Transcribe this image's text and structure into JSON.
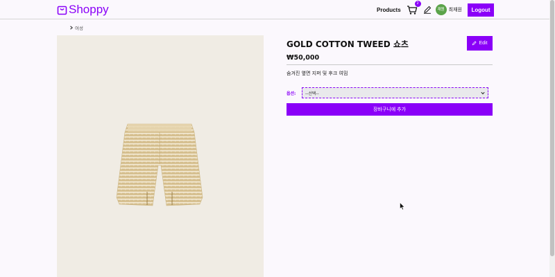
{
  "header": {
    "logo_text": "Shoppy",
    "nav_products": "Products",
    "cart_count": "2",
    "avatar_text": "재원",
    "username": "최재원",
    "logout_label": "Logout"
  },
  "breadcrumb": {
    "category": "여성"
  },
  "product": {
    "title": "GOLD COTTON TWEED 쇼츠",
    "price": "₩50,000",
    "description": "숨겨진 옆면 지퍼 및 후크 여밈",
    "edit_label": "Edit",
    "option_label": "옵션:",
    "option_selected": "--선택--",
    "add_to_cart_label": "장바구니에 추가"
  },
  "colors": {
    "accent": "#8a00f8",
    "avatar": "#5ba34a",
    "image_bg": "#f0ece4",
    "page_bg": "#fbf8fd"
  },
  "icons": [
    "shopping-bag-icon",
    "cart-icon",
    "pencil-icon",
    "chevron-right-icon",
    "chevron-down-icon",
    "mouse-cursor-icon"
  ]
}
